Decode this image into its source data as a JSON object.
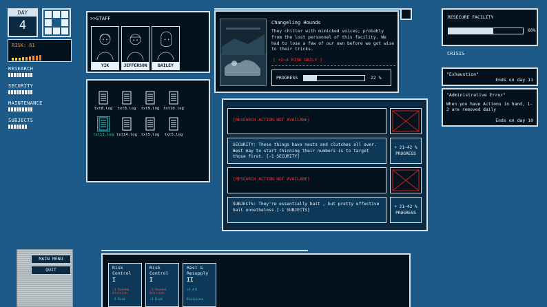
{
  "day": {
    "label": "DAY",
    "value": "4"
  },
  "risk": {
    "label": "RISK: 61",
    "value": 61
  },
  "stats": [
    {
      "label": "RESEARCH",
      "bars": 9
    },
    {
      "label": "SECURITY",
      "bars": 9
    },
    {
      "label": "MAINTENANCE",
      "bars": 9
    },
    {
      "label": "SUBJECTS",
      "bars": 7
    }
  ],
  "staff": {
    "title": ">>STAFF",
    "members": [
      "YIK",
      "JEFFERSON",
      "BAILEY"
    ]
  },
  "logs": {
    "files": [
      "txt8.log",
      "txt8.log",
      "txt9.log",
      "txt10.log",
      "txt13.log",
      "txt14.log",
      "txt5.log",
      "txt5.log"
    ],
    "selected_index": 4
  },
  "event": {
    "title": "Changeling Hounds",
    "description": "They chitter with mimicked voices; probably from the lost personnel of this facility. We had to lose a few of our own before we got wise to their tricks.",
    "risk_note": "[ +2~4 RISK DAILY ]",
    "progress_label": "PROGRESS",
    "progress_value": 22,
    "progress_text": "22 %"
  },
  "actions": [
    {
      "text": "[RESEARCH ACTION NOT AVAILABE]",
      "locked": true
    },
    {
      "text": "SECURITY: These things have nests and clutches all over. Best may to start thinning their numbers is to target those first. [-1 SECURITY]",
      "locked": false,
      "reward": "+ 21~42 %",
      "reward_label": "PROGRESS"
    },
    {
      "text": "[RESEARCH ACTION NOT AVAILABE]",
      "locked": true
    },
    {
      "text": "SUBJECTS: They're essentially bait , but pretty effective bait nonetheless.[-1 SUBJECTS]",
      "locked": false,
      "reward": "+ 21~42 %",
      "reward_label": "PROGRESS"
    }
  ],
  "facility": {
    "label": "RESECURE FACILITY",
    "value": 60,
    "value_text": "60%"
  },
  "crisis": {
    "label": "CRISIS",
    "items": [
      {
        "title": "\"Exhaustion\"",
        "body": "",
        "ends": "Ends on day 11"
      },
      {
        "title": "\"Administrative Error\"",
        "body": "When you have Actions in hand, 1-2 are removed daily",
        "ends": "Ends on day 10"
      }
    ]
  },
  "menu": {
    "main": "MAIN MENU",
    "quit": "QUIT"
  },
  "cards": [
    {
      "title": "Risk Control",
      "cost": "I",
      "line1": "-1 Random Division",
      "line2": "-5 Risk"
    },
    {
      "title": "Risk Control",
      "cost": "I",
      "line1": "-1 Random Division",
      "line2": "-3 Risk"
    },
    {
      "title": "Rest & Resupply",
      "cost": "II",
      "line1": "+2 All",
      "line2": "Divisions"
    }
  ],
  "colors": {
    "background": "#1e5a87",
    "panel": "#04121d",
    "danger": "#ff3030",
    "accent": "#39d6d1"
  }
}
